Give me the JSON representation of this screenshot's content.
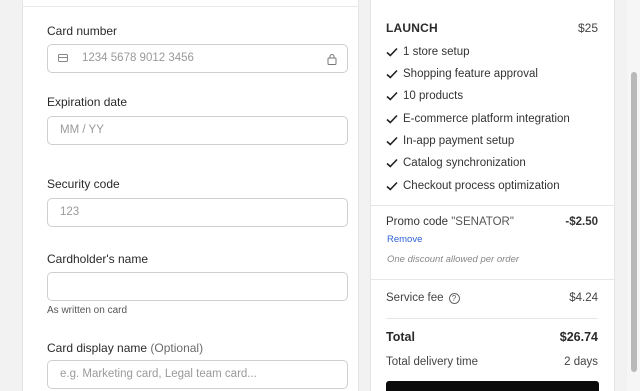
{
  "form": {
    "card_number": {
      "label": "Card number",
      "placeholder": "1234 5678 9012 3456"
    },
    "expiration": {
      "label": "Expiration date",
      "placeholder": "MM / YY"
    },
    "security": {
      "label": "Security code",
      "placeholder": "123"
    },
    "cardholder": {
      "label": "Cardholder's name",
      "value": "",
      "helper": "As written on card"
    },
    "display_name": {
      "label": "Card display name",
      "optional": "(Optional)",
      "placeholder": "e.g. Marketing card, Legal team card..."
    }
  },
  "summary": {
    "plan_name": "LAUNCH",
    "plan_price": "$25",
    "features": [
      "1 store setup",
      "Shopping feature approval",
      "10 products",
      "E-commerce platform integration",
      "In-app payment setup",
      "Catalog synchronization",
      "Checkout process optimization"
    ],
    "promo": {
      "label": "Promo code",
      "code": "\"SENATOR\"",
      "amount": "-$2.50",
      "remove": "Remove",
      "note": "One discount allowed per order"
    },
    "fee": {
      "label": "Service fee",
      "help": "?",
      "amount": "$4.24"
    },
    "total": {
      "label": "Total",
      "amount": "$26.74"
    },
    "delivery": {
      "label": "Total delivery time",
      "amount": "2 days"
    }
  }
}
